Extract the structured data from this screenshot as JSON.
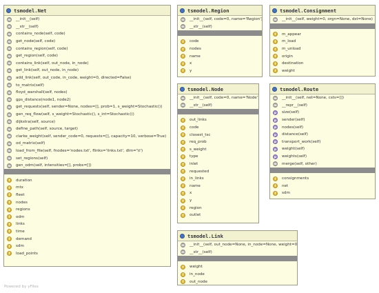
{
  "footer": "Powered by yFiles",
  "classes": {
    "net": {
      "title": "tsmodel.Net",
      "methods": [
        "__init__(self)",
        "__str__(self)",
        "contains_node(self, code)",
        "get_node(self, code)",
        "contains_region(self, code)",
        "get_region(self, code)",
        "contains_link(self, out_node, in_node)",
        "get_link(self, out_node, in_node)",
        "add_link(self, out_code, in_code, weight=0, directed=False)",
        "to_matrix(self)",
        "floyd_warshall(self, nodes)",
        "gps_distance(node1, node2)",
        "get_requests(self, sender=None, nodes=[], prob=1, s_weight=Stochastic())",
        "gen_req_flow(self, s_weight=Stochastic(), s_int=Stochastic())",
        "dijkstra(self, source)",
        "define_path(self, source, target)",
        "clarke_weight(self, sender_code=0, requests=[], capacity=10, verbose=True)",
        "od_matrix(self)",
        "load_from_file(self, fnodes='nodes.txt', flinks='links.txt', dlm='\\t')",
        "set_regions(self)",
        "gen_odm(self, intensities=[], probs=[])"
      ],
      "fields": [
        "duration",
        "mtx",
        "fleet",
        "nodes",
        "regions",
        "odm",
        "links",
        "time",
        "demand",
        "sdm",
        "load_points"
      ]
    },
    "region": {
      "title": "tsmodel.Region",
      "methods": [
        "__init__(self, code=0, name='Region')",
        "__str__(self)"
      ],
      "fields": [
        "code",
        "nodes",
        "name",
        "x",
        "y"
      ]
    },
    "consignment": {
      "title": "tsmodel.Consignment",
      "methods": [
        "__init__(self, weight=0, orgn=None, dst=None)"
      ],
      "fields": [
        "m_appear",
        "m_load",
        "m_unload",
        "origin",
        "destination",
        "weight"
      ]
    },
    "node": {
      "title": "tsmodel.Node",
      "methods": [
        "__init__(self, code=0, name='Node')",
        "__str__(self)"
      ],
      "fields": [
        "out_links",
        "code",
        "closest_tsc",
        "req_prob",
        "s_weight",
        "type",
        "inlet",
        "requested",
        "in_links",
        "name",
        "x",
        "y",
        "region",
        "outlet"
      ]
    },
    "route": {
      "title": "tsmodel.Route",
      "methods": [
        "__init__(self, net=None, csts=[])",
        "__repr__(self)"
      ],
      "properties": [
        "size(self)",
        "sender(self)",
        "nodes(self)",
        "distance(self)",
        "transport_work(self)",
        "weight(self)",
        "weights(self)"
      ],
      "methods2": [
        "merge(self, other)"
      ],
      "fields": [
        "consignments",
        "net",
        "sdm"
      ]
    },
    "link": {
      "title": "tsmodel.Link",
      "methods": [
        "__init__(self, out_node=None, in_node=None, weight=0)",
        "__str__(self)"
      ],
      "fields": [
        "weight",
        "in_node",
        "out_node"
      ]
    }
  }
}
